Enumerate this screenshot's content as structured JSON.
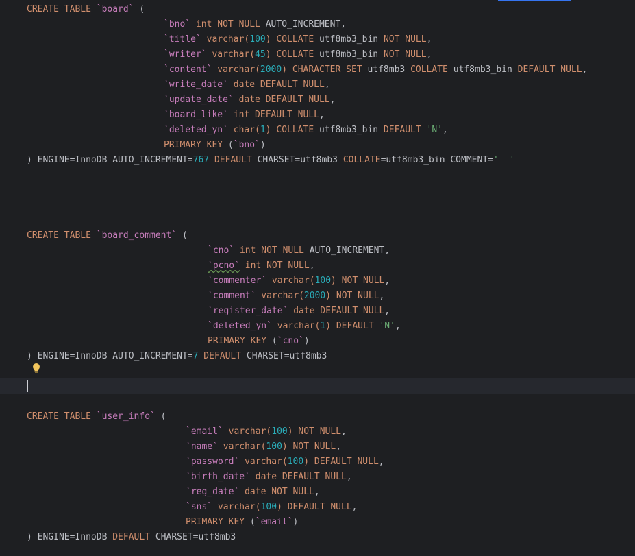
{
  "editor": {
    "theme_colors": {
      "background": "#1e1f22",
      "keyword": "#cf8e6d",
      "identifier": "#c77dbb",
      "number": "#2aacb8",
      "string": "#6aab73",
      "plain": "#bcbec4",
      "current_line": "#26282e",
      "accent": "#3574f0"
    },
    "icons": {
      "intention_bulb": "lightbulb-icon"
    },
    "lines": [
      {
        "indent": 0,
        "tokens": [
          [
            "CREATE TABLE ",
            "kw"
          ],
          [
            "`board`",
            "id"
          ],
          [
            " (",
            "txt"
          ]
        ]
      },
      {
        "indent": 25,
        "tokens": [
          [
            "`bno`",
            "id"
          ],
          [
            " int NOT NULL ",
            "kw"
          ],
          [
            "AUTO_INCREMENT,",
            "txt"
          ]
        ]
      },
      {
        "indent": 25,
        "tokens": [
          [
            "`title`",
            "id"
          ],
          [
            " varchar(",
            "kw"
          ],
          [
            "100",
            "num"
          ],
          [
            ") COLLATE ",
            "kw"
          ],
          [
            "utf8mb3_bin ",
            "txt"
          ],
          [
            "NOT NULL",
            "kw"
          ],
          [
            ",",
            "txt"
          ]
        ]
      },
      {
        "indent": 25,
        "tokens": [
          [
            "`writer`",
            "id"
          ],
          [
            " varchar(",
            "kw"
          ],
          [
            "45",
            "num"
          ],
          [
            ") COLLATE ",
            "kw"
          ],
          [
            "utf8mb3_bin ",
            "txt"
          ],
          [
            "NOT NULL",
            "kw"
          ],
          [
            ",",
            "txt"
          ]
        ]
      },
      {
        "indent": 25,
        "tokens": [
          [
            "`content`",
            "id"
          ],
          [
            " varchar(",
            "kw"
          ],
          [
            "2000",
            "num"
          ],
          [
            ") CHARACTER SET ",
            "kw"
          ],
          [
            "utf8mb3 ",
            "txt"
          ],
          [
            "COLLATE ",
            "kw"
          ],
          [
            "utf8mb3_bin ",
            "txt"
          ],
          [
            "DEFAULT NULL",
            "kw"
          ],
          [
            ",",
            "txt"
          ]
        ]
      },
      {
        "indent": 25,
        "tokens": [
          [
            "`write_date`",
            "id"
          ],
          [
            " date DEFAULT NULL",
            "kw"
          ],
          [
            ",",
            "txt"
          ]
        ]
      },
      {
        "indent": 25,
        "tokens": [
          [
            "`update_date`",
            "id"
          ],
          [
            " date DEFAULT NULL",
            "kw"
          ],
          [
            ",",
            "txt"
          ]
        ]
      },
      {
        "indent": 25,
        "tokens": [
          [
            "`board_like`",
            "id"
          ],
          [
            " int DEFAULT NULL",
            "kw"
          ],
          [
            ",",
            "txt"
          ]
        ]
      },
      {
        "indent": 25,
        "tokens": [
          [
            "`deleted_yn`",
            "id"
          ],
          [
            " char(",
            "kw"
          ],
          [
            "1",
            "num"
          ],
          [
            ") COLLATE ",
            "kw"
          ],
          [
            "utf8mb3_bin ",
            "txt"
          ],
          [
            "DEFAULT ",
            "kw"
          ],
          [
            "'N'",
            "str"
          ],
          [
            ",",
            "txt"
          ]
        ]
      },
      {
        "indent": 25,
        "tokens": [
          [
            "PRIMARY KEY ",
            "kw"
          ],
          [
            "(",
            "txt"
          ],
          [
            "`bno`",
            "id"
          ],
          [
            ")",
            "txt"
          ]
        ]
      },
      {
        "indent": 0,
        "tokens": [
          [
            ") ENGINE=InnoDB AUTO_INCREMENT=",
            "txt"
          ],
          [
            "767",
            "num"
          ],
          [
            " DEFAULT ",
            "kw"
          ],
          [
            "CHARSET=utf8mb3 ",
            "txt"
          ],
          [
            "COLLATE",
            "kw"
          ],
          [
            "=utf8mb3_bin COMMENT=",
            "txt"
          ],
          [
            "'  '",
            "str"
          ]
        ]
      },
      {
        "indent": 0,
        "tokens": []
      },
      {
        "indent": 0,
        "tokens": []
      },
      {
        "indent": 0,
        "tokens": []
      },
      {
        "indent": 0,
        "tokens": []
      },
      {
        "indent": 0,
        "tokens": [
          [
            "CREATE TABLE ",
            "kw"
          ],
          [
            "`board_comment`",
            "id"
          ],
          [
            " (",
            "txt"
          ]
        ]
      },
      {
        "indent": 33,
        "tokens": [
          [
            "`cno`",
            "id"
          ],
          [
            " int NOT NULL ",
            "kw"
          ],
          [
            "AUTO_INCREMENT,",
            "txt"
          ]
        ]
      },
      {
        "indent": 33,
        "tokens": [
          [
            "`pcno`",
            "id ww"
          ],
          [
            " int NOT NULL",
            "kw"
          ],
          [
            ",",
            "txt"
          ]
        ]
      },
      {
        "indent": 33,
        "tokens": [
          [
            "`commenter`",
            "id"
          ],
          [
            " varchar(",
            "kw"
          ],
          [
            "100",
            "num"
          ],
          [
            ") NOT NULL",
            "kw"
          ],
          [
            ",",
            "txt"
          ]
        ]
      },
      {
        "indent": 33,
        "tokens": [
          [
            "`comment`",
            "id"
          ],
          [
            " varchar(",
            "kw"
          ],
          [
            "2000",
            "num"
          ],
          [
            ") NOT NULL",
            "kw"
          ],
          [
            ",",
            "txt"
          ]
        ]
      },
      {
        "indent": 33,
        "tokens": [
          [
            "`register_date`",
            "id"
          ],
          [
            " date DEFAULT NULL",
            "kw"
          ],
          [
            ",",
            "txt"
          ]
        ]
      },
      {
        "indent": 33,
        "tokens": [
          [
            "`deleted_yn`",
            "id"
          ],
          [
            " varchar(",
            "kw"
          ],
          [
            "1",
            "num"
          ],
          [
            ") DEFAULT ",
            "kw"
          ],
          [
            "'N'",
            "str"
          ],
          [
            ",",
            "txt"
          ]
        ]
      },
      {
        "indent": 33,
        "tokens": [
          [
            "PRIMARY KEY ",
            "kw"
          ],
          [
            "(",
            "txt"
          ],
          [
            "`cno`",
            "id"
          ],
          [
            ")",
            "txt"
          ]
        ]
      },
      {
        "indent": 0,
        "tokens": [
          [
            ") ENGINE=InnoDB AUTO_INCREMENT=",
            "txt"
          ],
          [
            "7",
            "num"
          ],
          [
            " DEFAULT ",
            "kw"
          ],
          [
            "CHARSET=utf8mb3",
            "txt"
          ]
        ]
      },
      {
        "indent": 0,
        "tokens": []
      },
      {
        "indent": 0,
        "tokens": []
      },
      {
        "indent": 0,
        "tokens": []
      },
      {
        "indent": 0,
        "tokens": [
          [
            "CREATE TABLE ",
            "kw"
          ],
          [
            "`user_info`",
            "id"
          ],
          [
            " (",
            "txt"
          ]
        ]
      },
      {
        "indent": 29,
        "tokens": [
          [
            "`email`",
            "id"
          ],
          [
            " varchar(",
            "kw"
          ],
          [
            "100",
            "num"
          ],
          [
            ") NOT NULL",
            "kw"
          ],
          [
            ",",
            "txt"
          ]
        ]
      },
      {
        "indent": 29,
        "tokens": [
          [
            "`name`",
            "id"
          ],
          [
            " varchar(",
            "kw"
          ],
          [
            "100",
            "num"
          ],
          [
            ") NOT NULL",
            "kw"
          ],
          [
            ",",
            "txt"
          ]
        ]
      },
      {
        "indent": 29,
        "tokens": [
          [
            "`password`",
            "id"
          ],
          [
            " varchar(",
            "kw"
          ],
          [
            "100",
            "num"
          ],
          [
            ") DEFAULT NULL",
            "kw"
          ],
          [
            ",",
            "txt"
          ]
        ]
      },
      {
        "indent": 29,
        "tokens": [
          [
            "`birth_date`",
            "id"
          ],
          [
            " date DEFAULT NULL",
            "kw"
          ],
          [
            ",",
            "txt"
          ]
        ]
      },
      {
        "indent": 29,
        "tokens": [
          [
            "`reg_date`",
            "id"
          ],
          [
            " date NOT NULL",
            "kw"
          ],
          [
            ",",
            "txt"
          ]
        ]
      },
      {
        "indent": 29,
        "tokens": [
          [
            "`sns`",
            "id"
          ],
          [
            " varchar(",
            "kw"
          ],
          [
            "100",
            "num"
          ],
          [
            ") DEFAULT NULL",
            "kw"
          ],
          [
            ",",
            "txt"
          ]
        ]
      },
      {
        "indent": 29,
        "tokens": [
          [
            "PRIMARY KEY ",
            "kw"
          ],
          [
            "(",
            "txt"
          ],
          [
            "`email`",
            "id"
          ],
          [
            ")",
            "txt"
          ]
        ]
      },
      {
        "indent": 0,
        "tokens": [
          [
            ") ENGINE=InnoDB ",
            "txt"
          ],
          [
            "DEFAULT ",
            "kw"
          ],
          [
            "CHARSET=utf8mb3",
            "txt"
          ]
        ]
      }
    ]
  }
}
